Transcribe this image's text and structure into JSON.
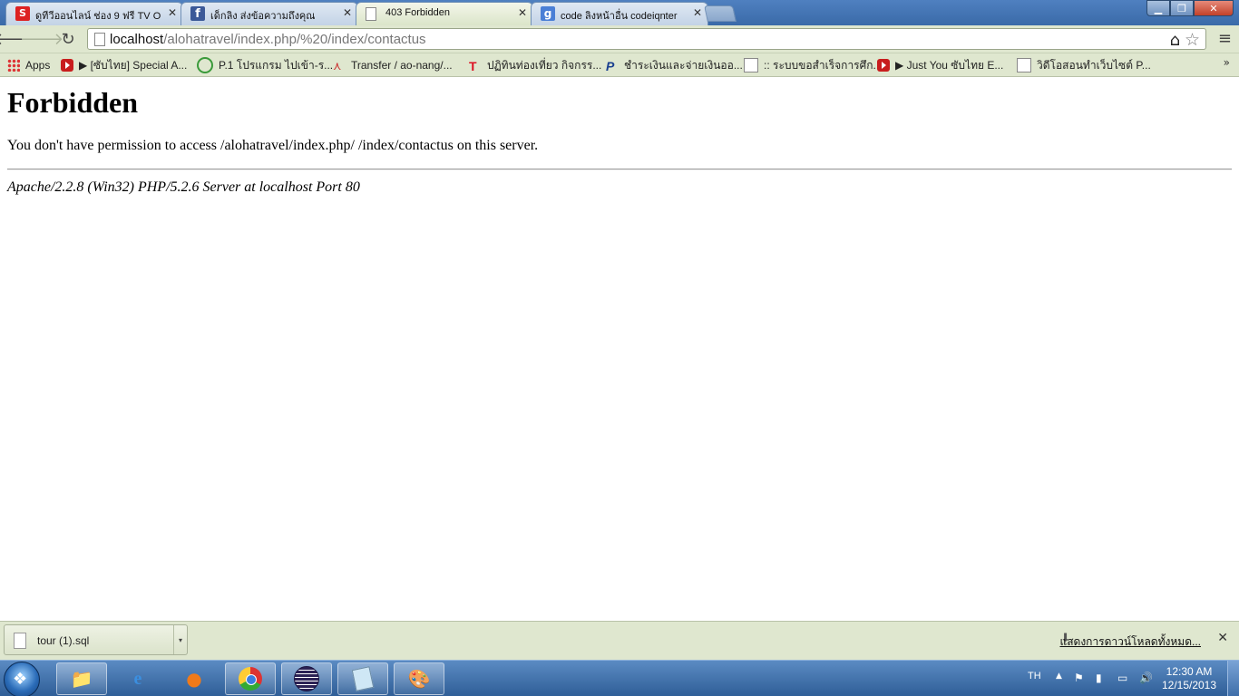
{
  "browser": {
    "tabs": [
      {
        "title": "ดูทีวีออนไลน์ ช่อง 9 ฟรี TV O",
        "favicon": "sanook-icon",
        "active": false
      },
      {
        "title": "เด็กลิง ส่งข้อความถึงคุณ",
        "favicon": "facebook-icon",
        "active": false
      },
      {
        "title": "403 Forbidden",
        "favicon": "page-icon",
        "active": true
      },
      {
        "title": "code ลิงหน้าอื่น codeiqnter",
        "favicon": "google-icon",
        "active": false
      }
    ],
    "url_host": "localhost",
    "url_path": "/alohatravel/index.php/%20/index/contactus"
  },
  "bookmarks": [
    {
      "label": "Apps",
      "icon": "apps-icon"
    },
    {
      "label": "▶ [ซับไทย] Special A...",
      "icon": "youtube-icon"
    },
    {
      "label": "P.1 โปรแกรม ไปเข้า-ร...",
      "icon": "refresh-icon"
    },
    {
      "label": "Transfer / ao-nang/...",
      "icon": "walker-icon"
    },
    {
      "label": "ปฏิทินท่องเที่ยว กิจกรร...",
      "icon": "t-icon"
    },
    {
      "label": "ชำระเงินและจ่ายเงินออ...",
      "icon": "paypal-icon"
    },
    {
      "label": ":: ระบบขอสำเร็จการศึก...",
      "icon": "doc-icon"
    },
    {
      "label": "▶ Just You ซับไทย E...",
      "icon": "youtube-icon"
    },
    {
      "label": "วิดีโอสอนทำเว็บไซต์ P...",
      "icon": "doc-icon"
    }
  ],
  "bookmarks_more": "»",
  "page": {
    "heading": "Forbidden",
    "message": "You don't have permission to access /alohatravel/index.php/ /index/contactus on this server.",
    "server_signature": "Apache/2.2.8 (Win32) PHP/5.2.6 Server at localhost Port 80"
  },
  "downloads": {
    "file": "tour (1).sql",
    "show_all": "แสดงการดาวน์โหลดทั้งหมด..."
  },
  "taskbar": {
    "apps": [
      "explorer-icon",
      "internet-explorer-icon",
      "firefox-icon",
      "chrome-icon",
      "eclipse-icon",
      "notepad-icon",
      "paint-icon"
    ],
    "language": "TH",
    "time": "12:30 AM",
    "date": "12/15/2013"
  }
}
